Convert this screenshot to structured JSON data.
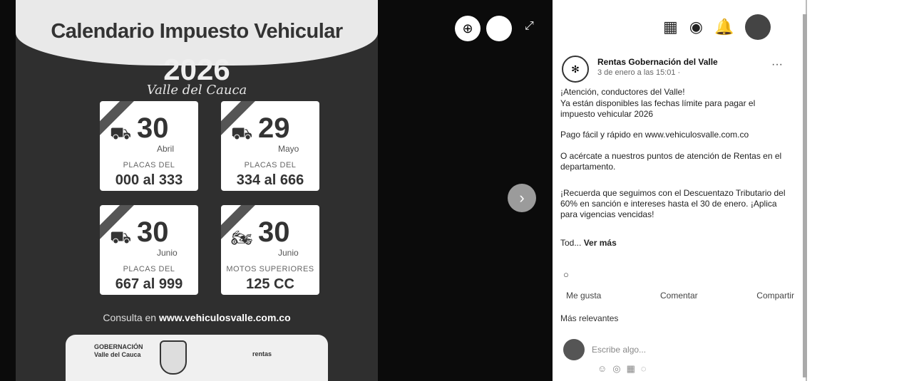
{
  "poster": {
    "title": "Calendario Impuesto Vehicular",
    "year": "2026",
    "subtitle": "Valle del Cauca",
    "cards": [
      {
        "day": "30",
        "month": "Abril",
        "label": "PLACAS DEL",
        "range": "000 al 333"
      },
      {
        "day": "29",
        "month": "Mayo",
        "label": "PLACAS DEL",
        "range": "334 al 666"
      },
      {
        "day": "30",
        "month": "Junio",
        "label": "PLACAS DEL",
        "range": "667 al 999"
      },
      {
        "day": "30",
        "month": "Junio",
        "label": "MOTOS SUPERIORES",
        "range": "125 CC"
      }
    ],
    "consult_prefix": "Consulta en",
    "consult_url": "www.vehiculosvalle.com.co",
    "footer_logo_text": "GOBERNACIÓN Valle del Cauca",
    "footer_logo2_text": "rentas"
  },
  "viewer": {
    "zoom_icon": "zoom-in-icon",
    "expand_icon": "expand-icon",
    "next_icon": "chevron-right-icon"
  },
  "post": {
    "page_name": "Rentas Gobernación del Valle",
    "time": "3 de enero a las 15:01 ·",
    "line1": "¡Atención, conductores del Valle!",
    "line2": "Ya están disponibles las fechas límite para pagar el impuesto vehicular 2026",
    "line3": "Pago fácil y rápido en www.vehiculosvalle.com.co",
    "line4": "O acércate a nuestros puntos de atención de Rentas en el departamento.",
    "line5": "¡Recuerda que seguimos con el Descuentazo Tributario del 60% en sanción e intereses hasta el 30 de enero. ¡Aplica para vigencias vencidas!",
    "see_more_prefix": "Tod...",
    "see_more": "Ver más",
    "actions": [
      "Me gusta",
      "Comentar",
      "Compartir"
    ],
    "relevant": "Más relevantes",
    "comment_placeholder": "Escribe algo..."
  }
}
